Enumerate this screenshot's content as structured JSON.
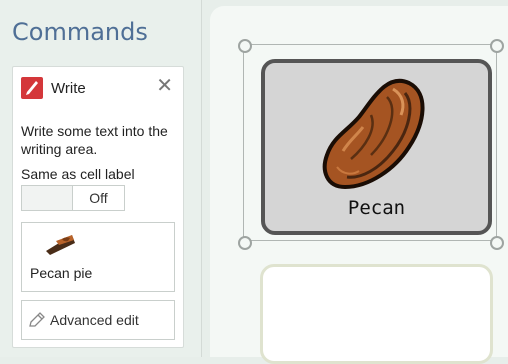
{
  "sidebar": {
    "title": "Commands"
  },
  "command": {
    "name": "Write",
    "icon": "pen-icon",
    "close": "✕",
    "description": "Write some text into the writing area.",
    "same_as_label": "Same as cell label",
    "toggle_value": "Off",
    "preview_label": "Pecan pie",
    "advanced_edit": "Advanced edit"
  },
  "grid": {
    "cells": [
      {
        "label": "Pecan",
        "symbol": "pecan-nut-image"
      },
      {
        "label": ""
      }
    ]
  },
  "colors": {
    "title": "#4f6f96",
    "write_icon": "#d4373a",
    "cell_border": "#555555"
  }
}
